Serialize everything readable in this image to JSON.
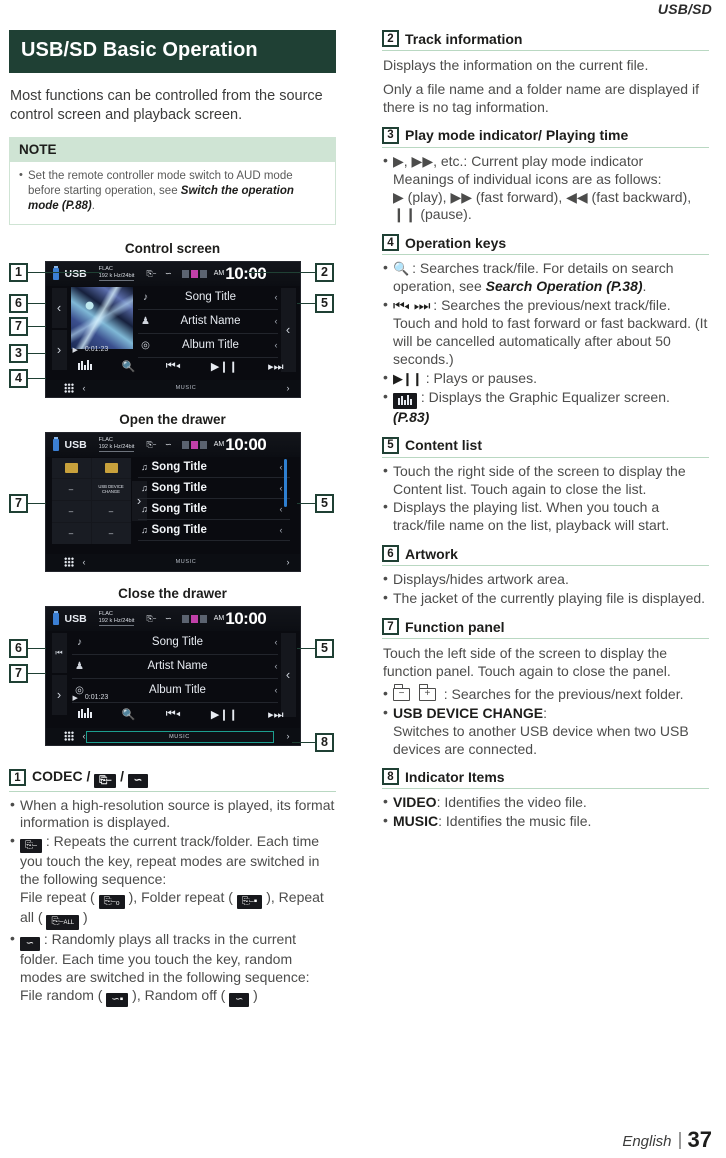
{
  "page": {
    "running_head": "USB/SD",
    "language": "English",
    "page_number": "37"
  },
  "chapter": {
    "title": "USB/SD Basic Operation",
    "lead": "Most functions can be controlled from the source control screen and playback screen."
  },
  "note": {
    "heading": "NOTE",
    "items": [
      {
        "pre": "Set the remote controller mode switch to AUD mode before starting operation, see ",
        "bold": "Switch the operation mode (P.88)",
        "post": "."
      }
    ]
  },
  "figures": {
    "control_screen": {
      "caption": "Control screen",
      "callouts": [
        "1",
        "2",
        "6",
        "5",
        "7",
        "3",
        "4"
      ]
    },
    "open_drawer": {
      "caption": "Open the drawer",
      "callouts": [
        "7",
        "5"
      ]
    },
    "close_drawer": {
      "caption": "Close the drawer",
      "callouts": [
        "6",
        "5",
        "7",
        "8"
      ]
    }
  },
  "device": {
    "source_label": "USB",
    "codec_line1": "FLAC",
    "codec_line2": "192 k Hz/24bit",
    "am_pm": "AM",
    "clock": "10:00",
    "rows": [
      {
        "icon": "music-note-icon",
        "glyph": "♪",
        "text": "Song Title",
        "chevron": "‹"
      },
      {
        "icon": "artist-icon",
        "glyph": "♟",
        "text": "Artist Name",
        "chevron": "‹"
      },
      {
        "icon": "disc-icon",
        "glyph": "◎",
        "text": "Album Title",
        "chevron": "‹"
      }
    ],
    "play_glyph": "▶",
    "elapsed": "0:01:23",
    "keys": [
      "equalizer-icon",
      "search-icon",
      "previous-icon",
      "play-pause-icon",
      "next-icon"
    ],
    "key_glyphs": [
      "",
      "⌕",
      "⏮◂",
      "▶❙❙",
      "▸⏭"
    ],
    "bottom_label": "MUSIC",
    "list_items": [
      "Song Title",
      "Song Title",
      "Song Title",
      "Song Title"
    ],
    "function_panel_cells": [
      "folder-minus",
      "folder-plus",
      "–",
      "USB DEVICE CHANGE",
      "–",
      "–",
      "–",
      "–"
    ],
    "usb_device_change_label": "USB DEVICE CHANGE"
  },
  "sections": [
    {
      "num": "1",
      "title_pre": "CODEC /",
      "title_icons": [
        "repeat-icon",
        "random-icon"
      ],
      "bullets": [
        {
          "text": "When a high-resolution source is played, its format information is displayed."
        },
        {
          "chip": "repeat-icon",
          "text": ": Repeats the current track/folder. Each time you touch the key, repeat modes are switched in the following sequence: File repeat (  ), Folder repeat (  ), Repeat all (  )",
          "seq": [
            "File repeat",
            "Folder repeat",
            "Repeat all"
          ]
        },
        {
          "chip": "random-icon",
          "text": ": Randomly plays all tracks in the current folder. Each time you touch the key, random modes are switched in the following sequence: File random (  ), Random off (  )",
          "seq": [
            "File random",
            "Random off"
          ]
        }
      ]
    },
    {
      "num": "2",
      "title": "Track information",
      "paras": [
        "Displays the information on the current file.",
        "Only a file name and a folder name are displayed if there is no tag information."
      ]
    },
    {
      "num": "3",
      "title": "Play mode indicator/ Playing time",
      "bullet_lines": [
        "▶, ▶▶, etc.: Current play mode indicator",
        "Meanings of individual icons are as follows:",
        "▶ (play), ▶▶ (fast forward), ◀◀ (fast backward), ❙❙ (pause)."
      ]
    },
    {
      "num": "4",
      "title": "Operation keys",
      "items": [
        {
          "glyph": "search-icon",
          "pre": ": Searches track/file. For details on search operation, see ",
          "bold": "Search Operation (P.38)",
          "post": "."
        },
        {
          "glyph": "prev-next-icon",
          "pre": ": Searches the previous/next track/file.",
          "extra": "Touch and hold to fast forward or fast backward. (It will be cancelled automatically after about 50 seconds.)"
        },
        {
          "glyph": "play-pause-icon",
          "pre": ": Plays or pauses."
        },
        {
          "glyph": "equalizer-chip",
          "pre": ": Displays the Graphic Equalizer screen. ",
          "bold": "(P.83)"
        }
      ]
    },
    {
      "num": "5",
      "title": "Content list",
      "bullets": [
        "Touch the right side of the screen to display the Content list. Touch again to close the list.",
        "Displays the playing list. When you touch a track/file name on the list, playback will start."
      ]
    },
    {
      "num": "6",
      "title": "Artwork",
      "bullets": [
        "Displays/hides artwork area.",
        "The jacket of the currently playing file is displayed."
      ]
    },
    {
      "num": "7",
      "title": "Function panel",
      "para": "Touch the left side of the screen to display the function panel. Touch again to close the panel.",
      "items": [
        {
          "glyph": "folder-prev-next-icon",
          "text": ": Searches for the previous/next folder."
        },
        {
          "bold": "USB DEVICE CHANGE",
          "colon": ":",
          "text": "Switches to another USB device when two USB devices are connected."
        }
      ]
    },
    {
      "num": "8",
      "title": "Indicator Items",
      "items": [
        {
          "bold": "VIDEO",
          "text": ": Identifies the video file."
        },
        {
          "bold": "MUSIC",
          "text": ": Identifies the music file."
        }
      ]
    }
  ],
  "colors": {
    "chapter_bg": "#1f4034",
    "note_bg": "#cfe4d4",
    "rule": "#b9d8c2",
    "body_text": "#4c4c4b"
  }
}
